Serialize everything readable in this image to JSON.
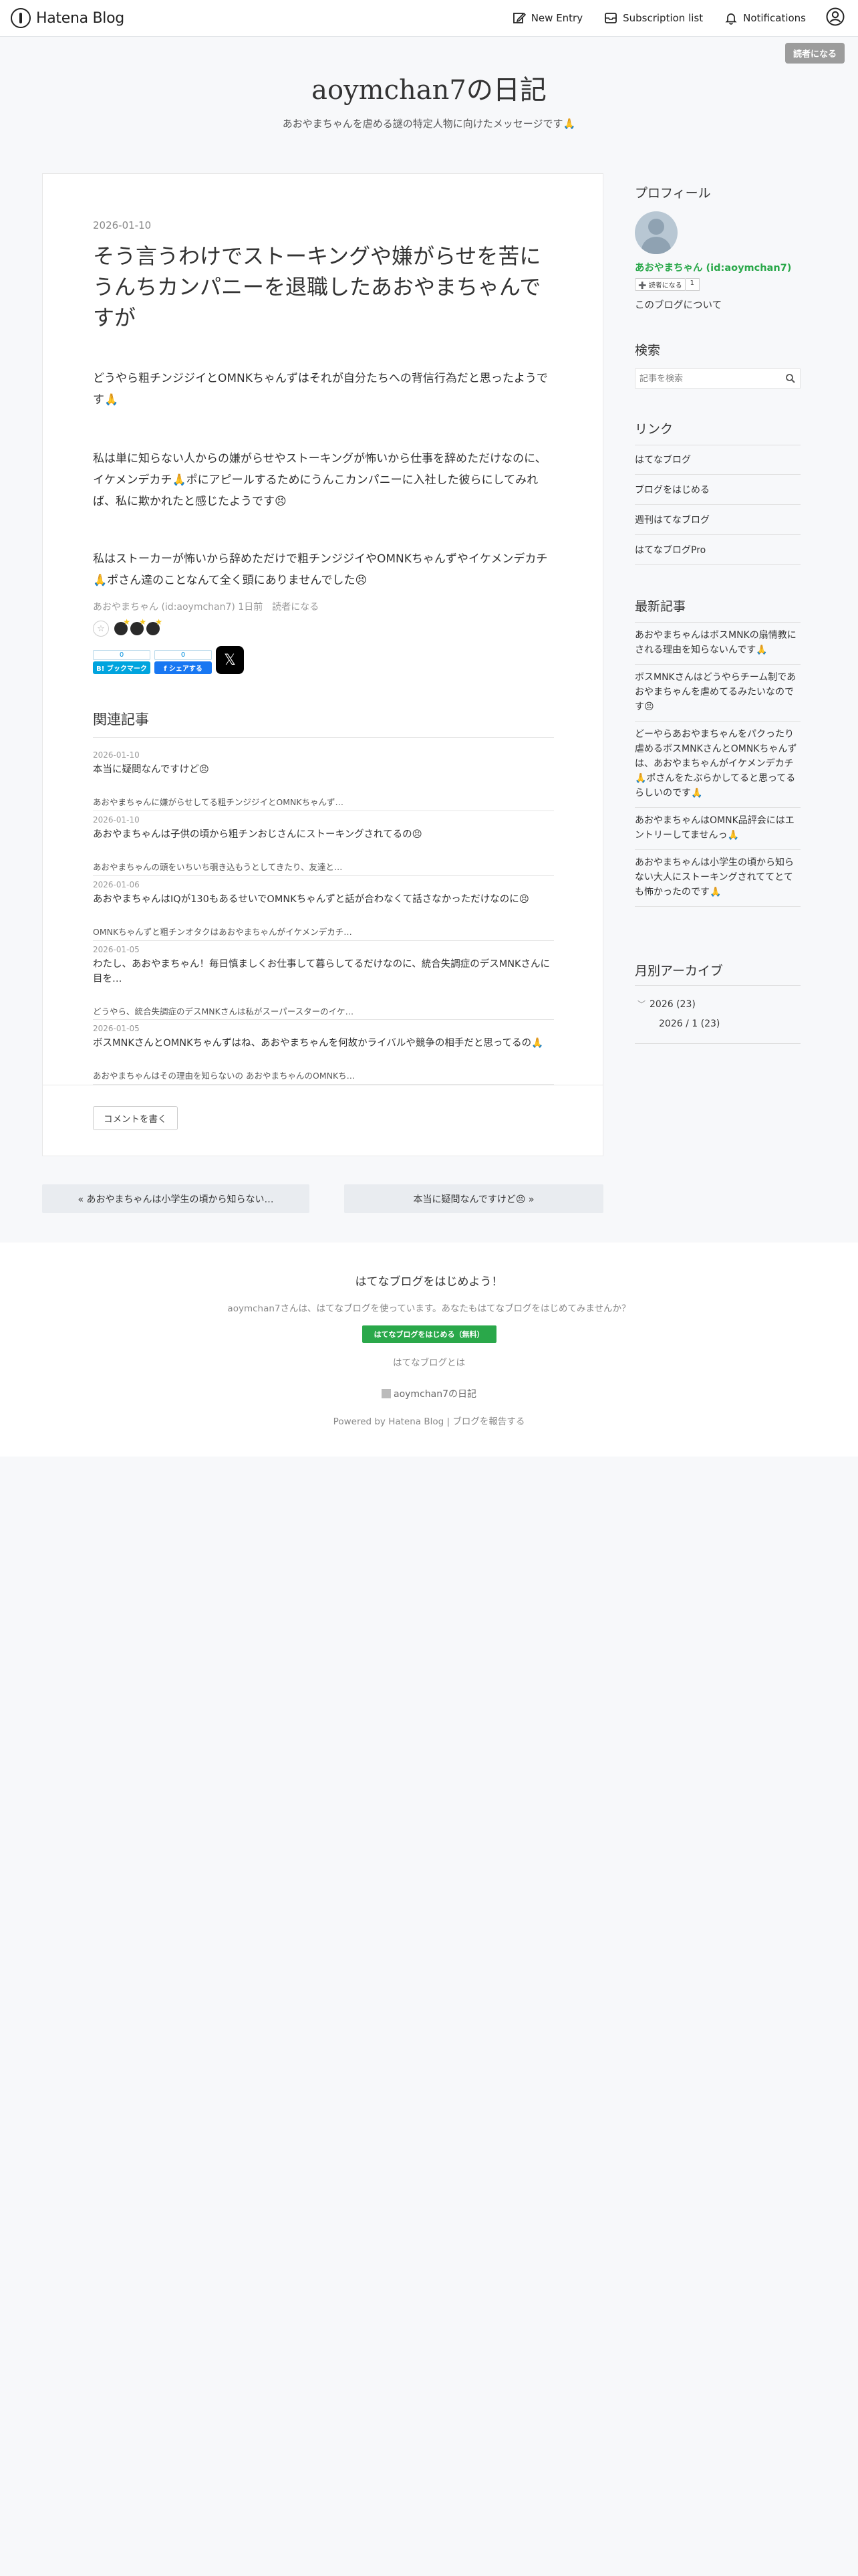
{
  "header": {
    "logo_text": "Hatena Blog",
    "new_entry": "New Entry",
    "subscription_list": "Subscription list",
    "notifications": "Notifications"
  },
  "subscribe_badge": "読者になる",
  "blog": {
    "title": "aoymchan7の日記",
    "description": "あおやまちゃんを虐める謎の特定人物に向けたメッセージです🙏"
  },
  "entry": {
    "date": "2026-01-10",
    "title": "そう言うわけでストーキングや嫌がらせを苦にうんちカンパニーを退職したあおやまちゃんですが",
    "paragraphs": [
      "どうやら粗チンジジイとOMNKちゃんずはそれが自分たちへの背信行為だと思ったようです🙏",
      "私は単に知らない人からの嫌がらせやストーキングが怖いから仕事を辞めただけなのに、イケメンデカチ🙏ポにアピールするためにうんこカンパニーに入社した彼らにしてみれば、私に欺かれたと感じたようです😣",
      "私はストーカーが怖いから辞めただけで粗チンジジイやOMNKちゃんずやイケメンデカチ🙏ポさん達のことなんて全く頭にありませんでした😣"
    ],
    "byline": "あおやまちゃん (id:aoymchan7) 1日前　読者になる",
    "add_star": "☆",
    "hatena_bookmark": {
      "count": "0",
      "label": "B! ブックマーク"
    },
    "facebook": {
      "count": "0",
      "label": "f シェアする"
    },
    "x_label": "𝕏"
  },
  "related": {
    "heading": "関連記事",
    "items": [
      {
        "date": "2026-01-10",
        "title": "本当に疑問なんですけど😣",
        "snippet": "あおやまちゃんに嫌がらせしてる粗チンジジイとOMNKちゃんず…"
      },
      {
        "date": "2026-01-10",
        "title": "あおやまちゃんは子供の頃から粗チンおじさんにストーキングされてるの😣",
        "snippet": "あおやまちゃんの頭をいちいち覗き込もうとしてきたり、友達と…"
      },
      {
        "date": "2026-01-06",
        "title": "あおやまちゃんはIQが130もあるせいでOMNKちゃんずと話が合わなくて話さなかっただけなのに😣",
        "snippet": "OMNKちゃんずと粗チンオタクはあおやまちゃんがイケメンデカチ…"
      },
      {
        "date": "2026-01-05",
        "title": "わたし、あおやまちゃん！毎日慎ましくお仕事して暮らしてるだけなのに、統合失調症のデスMNKさんに目を…",
        "snippet": "どうやら、統合失調症のデスMNKさんは私がスーパースターのイケ…"
      },
      {
        "date": "2026-01-05",
        "title": "ボスMNKさんとOMNKちゃんずはね、あおやまちゃんを何故かライバルや競争の相手だと思ってるの🙏",
        "snippet": "あおやまちゃんはその理由を知らないの あおやまちゃんのOMNKち…"
      }
    ]
  },
  "comment_button": "コメントを書く",
  "pager": {
    "prev": "« あおやまちゃんは小学生の頃から知らない…",
    "next": "本当に疑問なんですけど😣 »"
  },
  "sidebar": {
    "profile": {
      "heading": "プロフィール",
      "name": "あおやまちゃん (id:aoymchan7)",
      "reader_button": "➕ 読者になる",
      "reader_count": "1",
      "about": "このブログについて"
    },
    "search": {
      "heading": "検索",
      "placeholder": "記事を検索"
    },
    "links": {
      "heading": "リンク",
      "items": [
        "はてなブログ",
        "ブログをはじめる",
        "週刊はてなブログ",
        "はてなブログPro"
      ]
    },
    "recent": {
      "heading": "最新記事",
      "items": [
        "あおやまちゃんはボスMNKの扇情教にされる理由を知らないんです🙏",
        "ボスMNKさんはどうやらチーム制であおやまちゃんを虐めてるみたいなのです😣",
        "どーやらあおやまちゃんをパクったり虐めるボスMNKさんとOMNKちゃんずは、あおやまちゃんがイケメンデカチ🙏ポさんをたぶらかしてると思ってるらしいのです🙏",
        "あおやまちゃんはOMNK品評会にはエントリーしてませんっ🙏",
        "あおやまちゃんは小学生の頃から知らない大人にストーキングされててとても怖かったのです🙏"
      ]
    },
    "archive": {
      "heading": "月別アーカイブ",
      "year": "2026 (23)",
      "month": "2026 / 1 (23)"
    }
  },
  "footer": {
    "title": "はてなブログをはじめよう！",
    "description": "aoymchan7さんは、はてなブログを使っています。あなたもはてなブログをはじめてみませんか？",
    "start_button": "はてなブログをはじめる（無料）",
    "about": "はてなブログとは",
    "blog_name": "aoymchan7の日記",
    "powered": "Powered by Hatena Blog | ブログを報告する"
  },
  "colors": {
    "accent_green": "#2aa84a",
    "hatena_blue": "#00a4de",
    "facebook_blue": "#1877f2",
    "page_bg": "#f7f8fa"
  }
}
